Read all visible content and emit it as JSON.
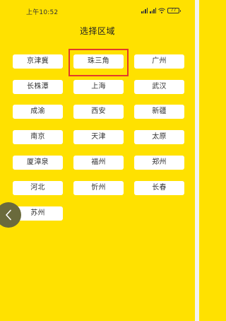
{
  "status_bar": {
    "time": "上午10:52",
    "battery": "77"
  },
  "header": {
    "title": "选择区域"
  },
  "regions": [
    "京津冀",
    "珠三角",
    "广州",
    "长株潭",
    "上海",
    "武汉",
    "成渝",
    "西安",
    "新疆",
    "南京",
    "天津",
    "太原",
    "厦漳泉",
    "福州",
    "郑州",
    "河北",
    "忻州",
    "长春",
    "苏州"
  ],
  "highlighted_region": "珠三角",
  "icons": {
    "back": "chevron-left-icon",
    "signal": "signal-icon",
    "wifi": "wifi-icon",
    "battery": "battery-icon"
  },
  "colors": {
    "background": "#ffe100",
    "button": "#ffffff",
    "highlight": "#e23b2a",
    "back_handle": "#6a6a3c"
  }
}
